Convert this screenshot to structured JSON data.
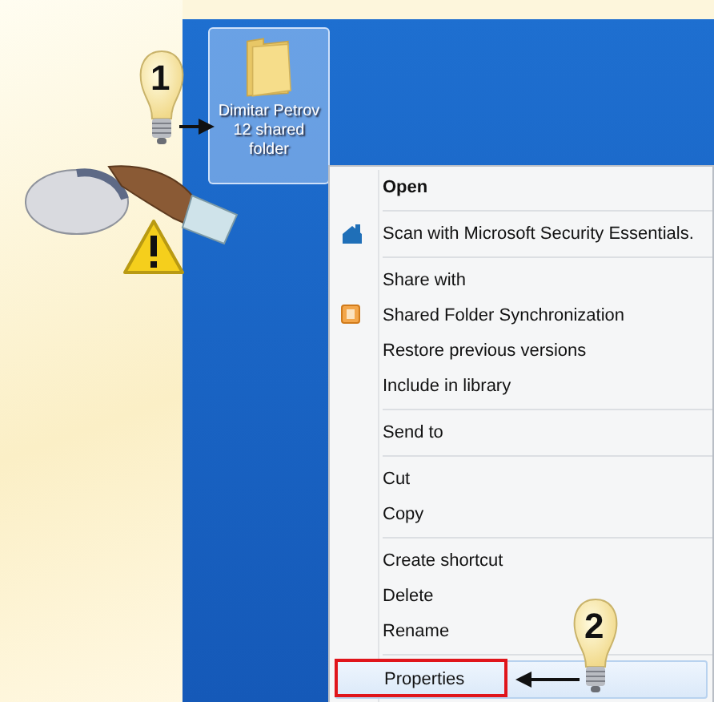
{
  "annotations": [
    {
      "kind": "step",
      "number": "1"
    },
    {
      "kind": "step",
      "number": "2"
    }
  ],
  "desktop": {
    "icon": {
      "label": "Dimitar Petrov 12 shared folder",
      "selected": true
    }
  },
  "context_menu": {
    "groups": [
      [
        {
          "label": "Open",
          "kind": "default",
          "selected": false
        }
      ],
      [
        {
          "label": "Scan with Microsoft Security Essentials.",
          "kind": "scan",
          "selected": false
        }
      ],
      [
        {
          "label": "Share with",
          "kind": "command",
          "selected": false
        },
        {
          "label": "Shared Folder Synchronization",
          "kind": "sync",
          "selected": false
        },
        {
          "label": "Restore previous versions",
          "kind": "command",
          "selected": false
        },
        {
          "label": "Include in library",
          "kind": "command",
          "selected": false
        }
      ],
      [
        {
          "label": "Send to",
          "kind": "command",
          "selected": false
        }
      ],
      [
        {
          "label": "Cut",
          "kind": "command",
          "selected": false
        },
        {
          "label": "Copy",
          "kind": "command",
          "selected": false
        }
      ],
      [
        {
          "label": "Create shortcut",
          "kind": "command",
          "selected": false
        },
        {
          "label": "Delete",
          "kind": "command",
          "selected": false
        },
        {
          "label": "Rename",
          "kind": "command",
          "selected": false
        }
      ],
      [
        {
          "label": "Properties",
          "kind": "command",
          "selected": true
        }
      ]
    ]
  }
}
